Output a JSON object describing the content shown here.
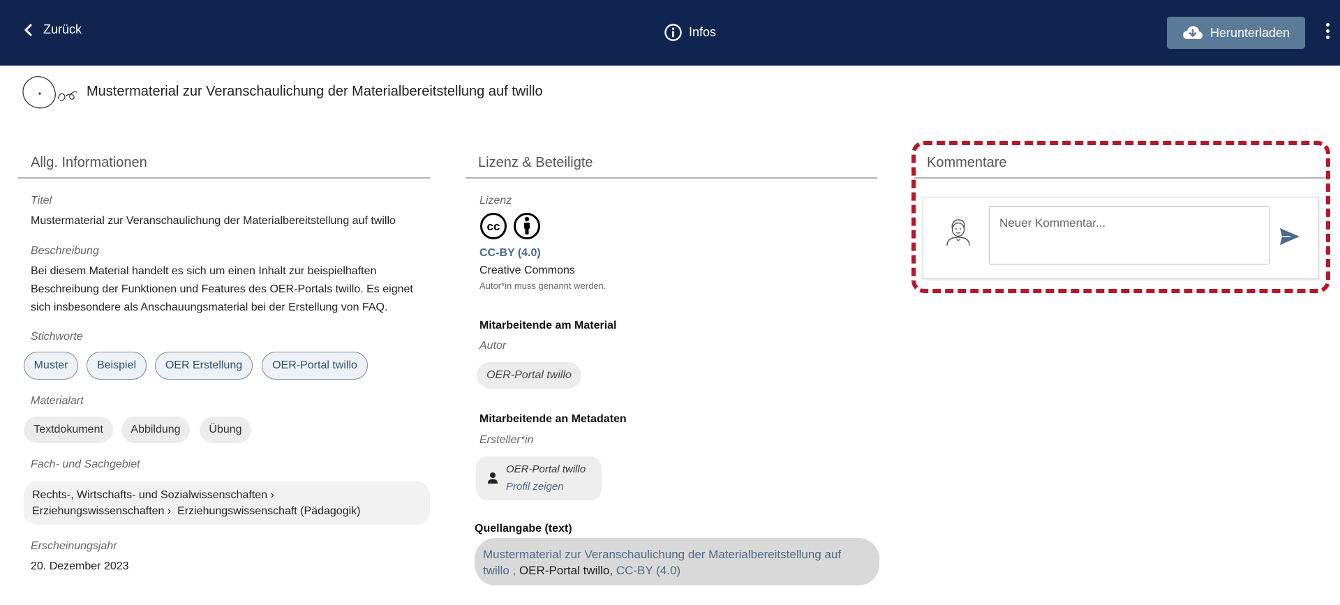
{
  "header": {
    "back_label": "Zurück",
    "infos_label": "Infos",
    "download_label": "Herunterladen"
  },
  "title": "Mustermaterial zur Veranschaulichung der Materialbereitstellung auf twillo",
  "general": {
    "heading": "Allg. Informationen",
    "title_label": "Titel",
    "title_value": "Mustermaterial zur Veranschaulichung der Materialbereitstellung auf twillo",
    "description_label": "Beschreibung",
    "description_lines": [
      "Bei diesem Material handelt es sich um einen Inhalt zur beispielhaften",
      "Beschreibung der Funktionen und Features des OER-Portals twillo. Es eignet",
      "sich insbesondere als Anschauungsmaterial bei der Erstellung von FAQ."
    ],
    "keywords_label": "Stichworte",
    "keywords": [
      "Muster",
      "Beispiel",
      "OER Erstellung",
      "OER-Portal twillo"
    ],
    "material_type_label": "Materialart",
    "material_types": [
      "Textdokument",
      "Abbildung",
      "Übung"
    ],
    "subject_label": "Fach- und Sachgebiet",
    "subjects": [
      "Rechts-, Wirtschafts- und Sozialwissenschaften",
      "Erziehungswissenschaften",
      "Erziehungswissenschaft (Pädagogik)"
    ],
    "year_label": "Erscheinungsjahr",
    "year_value": "20. Dezember 2023"
  },
  "license": {
    "heading": "Lizenz & Beteiligte",
    "license_label": "Lizenz",
    "license_code": "CC-BY (4.0)",
    "license_name": "Creative Commons",
    "license_note": "Autor*in muss genannt werden.",
    "contributors_material_heading": "Mitarbeitende am Material",
    "author_role": "Autor",
    "author_name": "OER-Portal twillo",
    "contributors_metadata_heading": "Mitarbeitende an Metadaten",
    "creator_role": "Ersteller*in",
    "creator_name": "OER-Portal twillo",
    "profile_link": "Profil zeigen",
    "citation_heading": "Quellangabe (text)",
    "citation_title_line1": "Mustermaterial zur Veranschaulichung der Materialbereitstellung auf",
    "citation_title_line2": "twillo ,",
    "citation_publisher": " OER-Portal twillo, ",
    "citation_license": "CC-BY (4.0)"
  },
  "comments": {
    "heading": "Kommentare",
    "placeholder": "Neuer Kommentar..."
  },
  "colors": {
    "header_bg": "#0f2550",
    "download_bg": "#5b7a98",
    "link": "#4a6a8a",
    "highlight": "#b7182a"
  }
}
